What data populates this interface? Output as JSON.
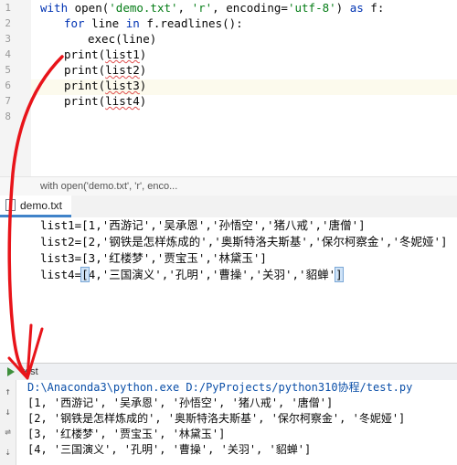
{
  "editor": {
    "lines": [
      {
        "num": "1",
        "pre": "",
        "kw1": "with",
        "mid": " open(",
        "s1": "'demo.txt'",
        "c1": ", ",
        "s2": "'r'",
        "c2": ", encoding=",
        "s3": "'utf-8'",
        "post": ") ",
        "kw2": "as",
        "tail": " f:"
      },
      {
        "num": "2",
        "text_kw": "for",
        "text_a": " line ",
        "text_kw2": "in",
        "text_b": " f.readlines():"
      },
      {
        "num": "3",
        "text": "exec(line)"
      },
      {
        "num": "4",
        "fn": "print(",
        "arg": "list1",
        "close": ")"
      },
      {
        "num": "5",
        "fn": "print(",
        "arg": "list2",
        "close": ")"
      },
      {
        "num": "6",
        "fn": "print(",
        "arg": "list3",
        "close": ")"
      },
      {
        "num": "7",
        "fn": "print(",
        "arg": "list4",
        "close": ")"
      },
      {
        "num": "8"
      }
    ],
    "breadcrumb": "with open('demo.txt', 'r', enco..."
  },
  "txt_tab": {
    "label": "demo.txt"
  },
  "txt_lines": [
    "list1=[1,'西游记','吴承恩','孙悟空','猪八戒','唐僧']",
    "list2=[2,'钢铁是怎样炼成的','奥斯特洛夫斯基','保尔柯察金','冬妮娅']",
    "list3=[3,'红楼梦','贾宝玉','林黛玉']",
    "list4=",
    "[",
    "4,'三国演义','孔明','曹操','关羽','貂蝉'",
    "]"
  ],
  "run": {
    "tab_label": "test",
    "command_path": "D:\\Anaconda3\\python.exe D:/PyProjects/python310协程/test.py",
    "output": [
      "[1, '西游记', '吴承恩', '孙悟空', '猪八戒', '唐僧']",
      "[2, '钢铁是怎样炼成的', '奥斯特洛夫斯基', '保尔柯察金', '冬妮娅']",
      "[3, '红楼梦', '贾宝玉', '林黛玉']",
      "[4, '三国演义', '孔明', '曹操', '关羽', '貂蝉']"
    ],
    "tool_icons": [
      "up-arrow-icon",
      "down-arrow-icon",
      "soft-wrap-icon",
      "scroll-to-end-icon"
    ]
  },
  "colors": {
    "annotation": "#e8141a",
    "keyword": "#0033b3",
    "string": "#067d17",
    "tab_accent": "#4083c9"
  }
}
